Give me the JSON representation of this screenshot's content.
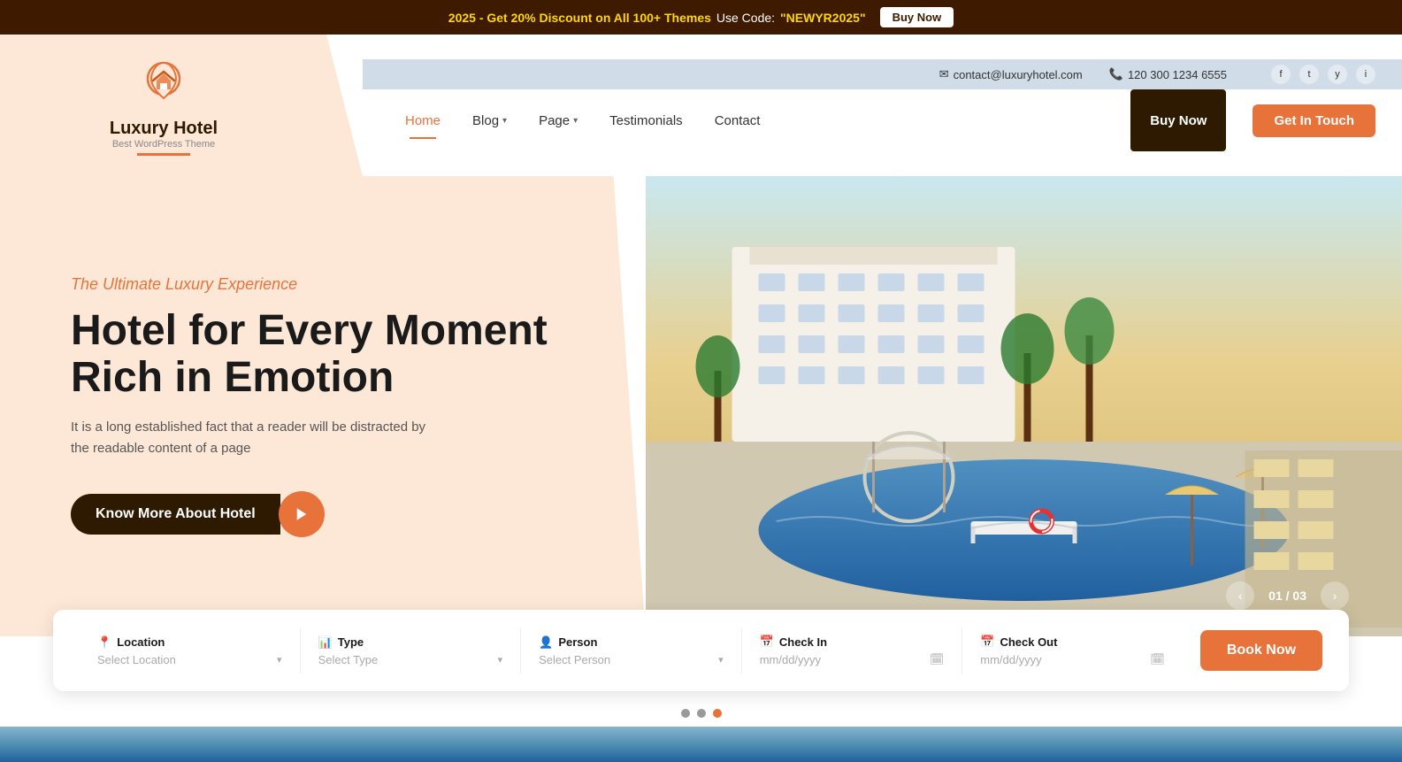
{
  "topBanner": {
    "promo": "2025 - Get 20% Discount on All 100+ Themes",
    "useCode": "Use Code:",
    "code": "\"NEWYR2025\"",
    "buyNow": "Buy Now"
  },
  "header": {
    "logo": {
      "name": "Luxury Hotel",
      "tagline": "Best WordPress Theme"
    },
    "contactInfo": {
      "email": "contact@luxuryhotel.com",
      "phone": "120 300 1234 6555"
    },
    "socialIcons": [
      "f",
      "t",
      "y",
      "i"
    ],
    "nav": {
      "items": [
        {
          "label": "Home",
          "active": true,
          "hasDropdown": false
        },
        {
          "label": "Blog",
          "active": false,
          "hasDropdown": true
        },
        {
          "label": "Page",
          "active": false,
          "hasDropdown": true
        },
        {
          "label": "Testimonials",
          "active": false,
          "hasDropdown": false
        },
        {
          "label": "Contact",
          "active": false,
          "hasDropdown": false
        }
      ],
      "buyLabel": "Buy Now",
      "getInTouchLabel": "Get In Touch"
    }
  },
  "hero": {
    "subtitle": "The Ultimate Luxury Experience",
    "title1": "Hotel for Every Moment",
    "title2": "Rich in Emotion",
    "description": "It is a long established fact that a reader will be distracted by the readable content of a page",
    "ctaLabel": "Know More About Hotel",
    "sliderCurrent": "01",
    "sliderTotal": "03"
  },
  "booking": {
    "fields": [
      {
        "icon": "📍",
        "label": "Location",
        "placeholder": "Select Location",
        "type": "select"
      },
      {
        "icon": "📊",
        "label": "Type",
        "placeholder": "Select Type",
        "type": "select"
      },
      {
        "icon": "👤",
        "label": "Person",
        "placeholder": "Select Person",
        "type": "select"
      },
      {
        "icon": "📅",
        "label": "Check In",
        "placeholder": "mm/dd/yyyy",
        "type": "date"
      },
      {
        "icon": "📅",
        "label": "Check Out",
        "placeholder": "mm/dd/yyyy",
        "type": "date"
      }
    ],
    "bookLabel": "Book Now"
  },
  "dots": [
    {
      "active": false
    },
    {
      "active": false,
      "semi": true
    },
    {
      "active": true
    }
  ]
}
